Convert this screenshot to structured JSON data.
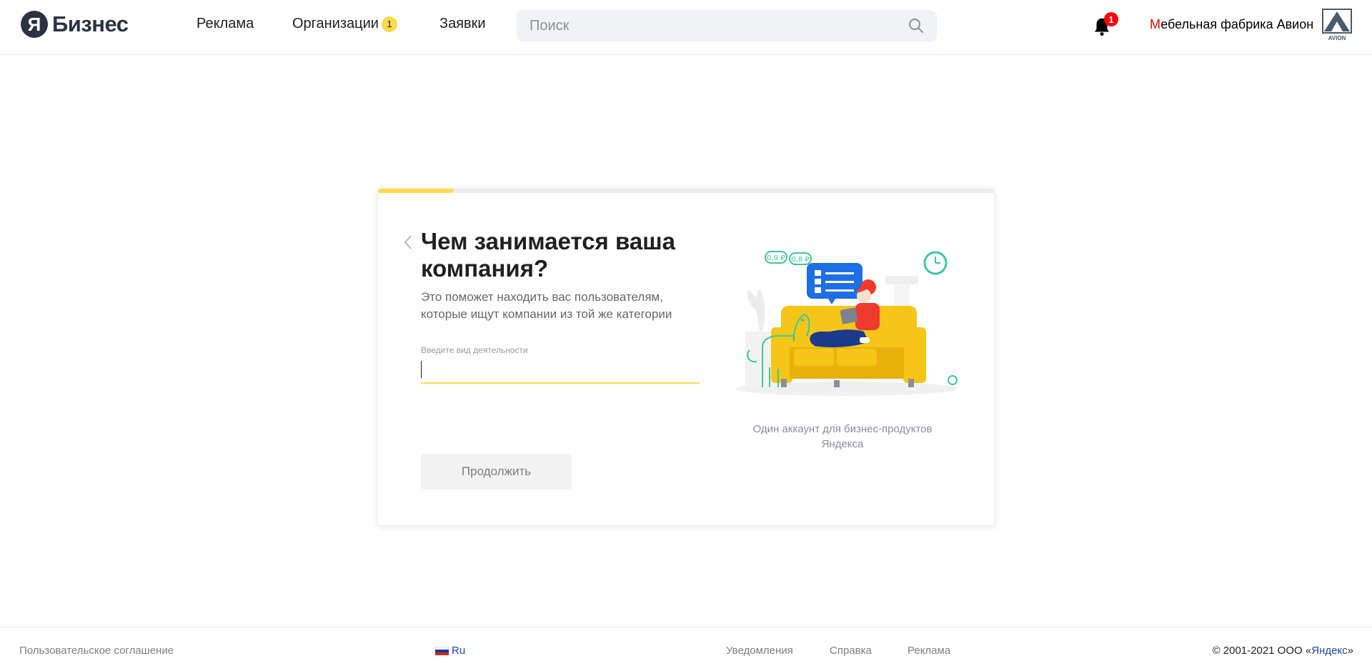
{
  "header": {
    "logo_letter": "Я",
    "logo_text": "Бизнес",
    "nav": [
      {
        "label": "Реклама"
      },
      {
        "label": "Организации",
        "badge": "1"
      },
      {
        "label": "Заявки"
      }
    ],
    "search_placeholder": "Поиск",
    "notifications_badge": "1",
    "account_first_letter": "М",
    "account_rest": "ебельная фабрика Авион",
    "account_logo_text": "AVION"
  },
  "card": {
    "progress_fraction": 0.122,
    "title": "Чем занимается ваша компания?",
    "subtitle": "Это поможет находить вас пользователям, которые ищут компании из той же категории",
    "field_label": "Введите вид деятельности",
    "field_value": "",
    "continue_label": "Продолжить",
    "illustration_tags": [
      "0,9 ₽",
      "0,8 ₽"
    ],
    "illustration_caption": "Один аккаунт для бизнес-продуктов Яндекса"
  },
  "footer": {
    "agreement": "Пользовательское соглашение",
    "lang": "Ru",
    "links": [
      "Уведомления",
      "Справка",
      "Реклама"
    ],
    "copyright_prefix": "© 2001-2021  ООО «",
    "copyright_company": "Яндекс",
    "copyright_suffix": "»"
  },
  "colors": {
    "accent_yellow": "#ffdb4d",
    "notification_red": "#ff0000",
    "link_blue": "#1e47a8"
  }
}
